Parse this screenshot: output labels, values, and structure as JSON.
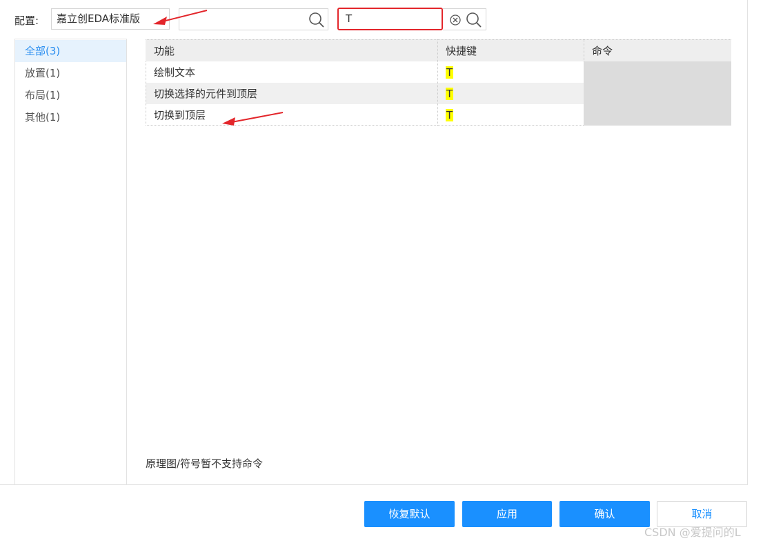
{
  "config": {
    "label": "配置:",
    "selected": "嘉立创EDA标准版"
  },
  "search": {
    "value": ""
  },
  "key_search": {
    "value": "T"
  },
  "categories": [
    {
      "label": "全部(3)",
      "active": true
    },
    {
      "label": "放置(1)",
      "active": false
    },
    {
      "label": "布局(1)",
      "active": false
    },
    {
      "label": "其他(1)",
      "active": false
    }
  ],
  "table": {
    "headers": [
      "功能",
      "快捷键",
      "命令"
    ],
    "rows": [
      {
        "function": "绘制文本",
        "shortcut": "T"
      },
      {
        "function": "切换选择的元件到顶层",
        "shortcut": "T"
      },
      {
        "function": "切换到顶层",
        "shortcut": "T"
      }
    ]
  },
  "note": "原理图/符号暂不支持命令",
  "buttons": {
    "restore": "恢复默认",
    "apply": "应用",
    "confirm": "确认",
    "cancel": "取消"
  },
  "watermark": "CSDN @爱提问的L",
  "colors": {
    "accent": "#1a90ff",
    "highlight": "#ffff00",
    "annotation": "#e3262b"
  },
  "icons": {
    "search": "search-icon",
    "clear": "clear-circle-icon"
  }
}
